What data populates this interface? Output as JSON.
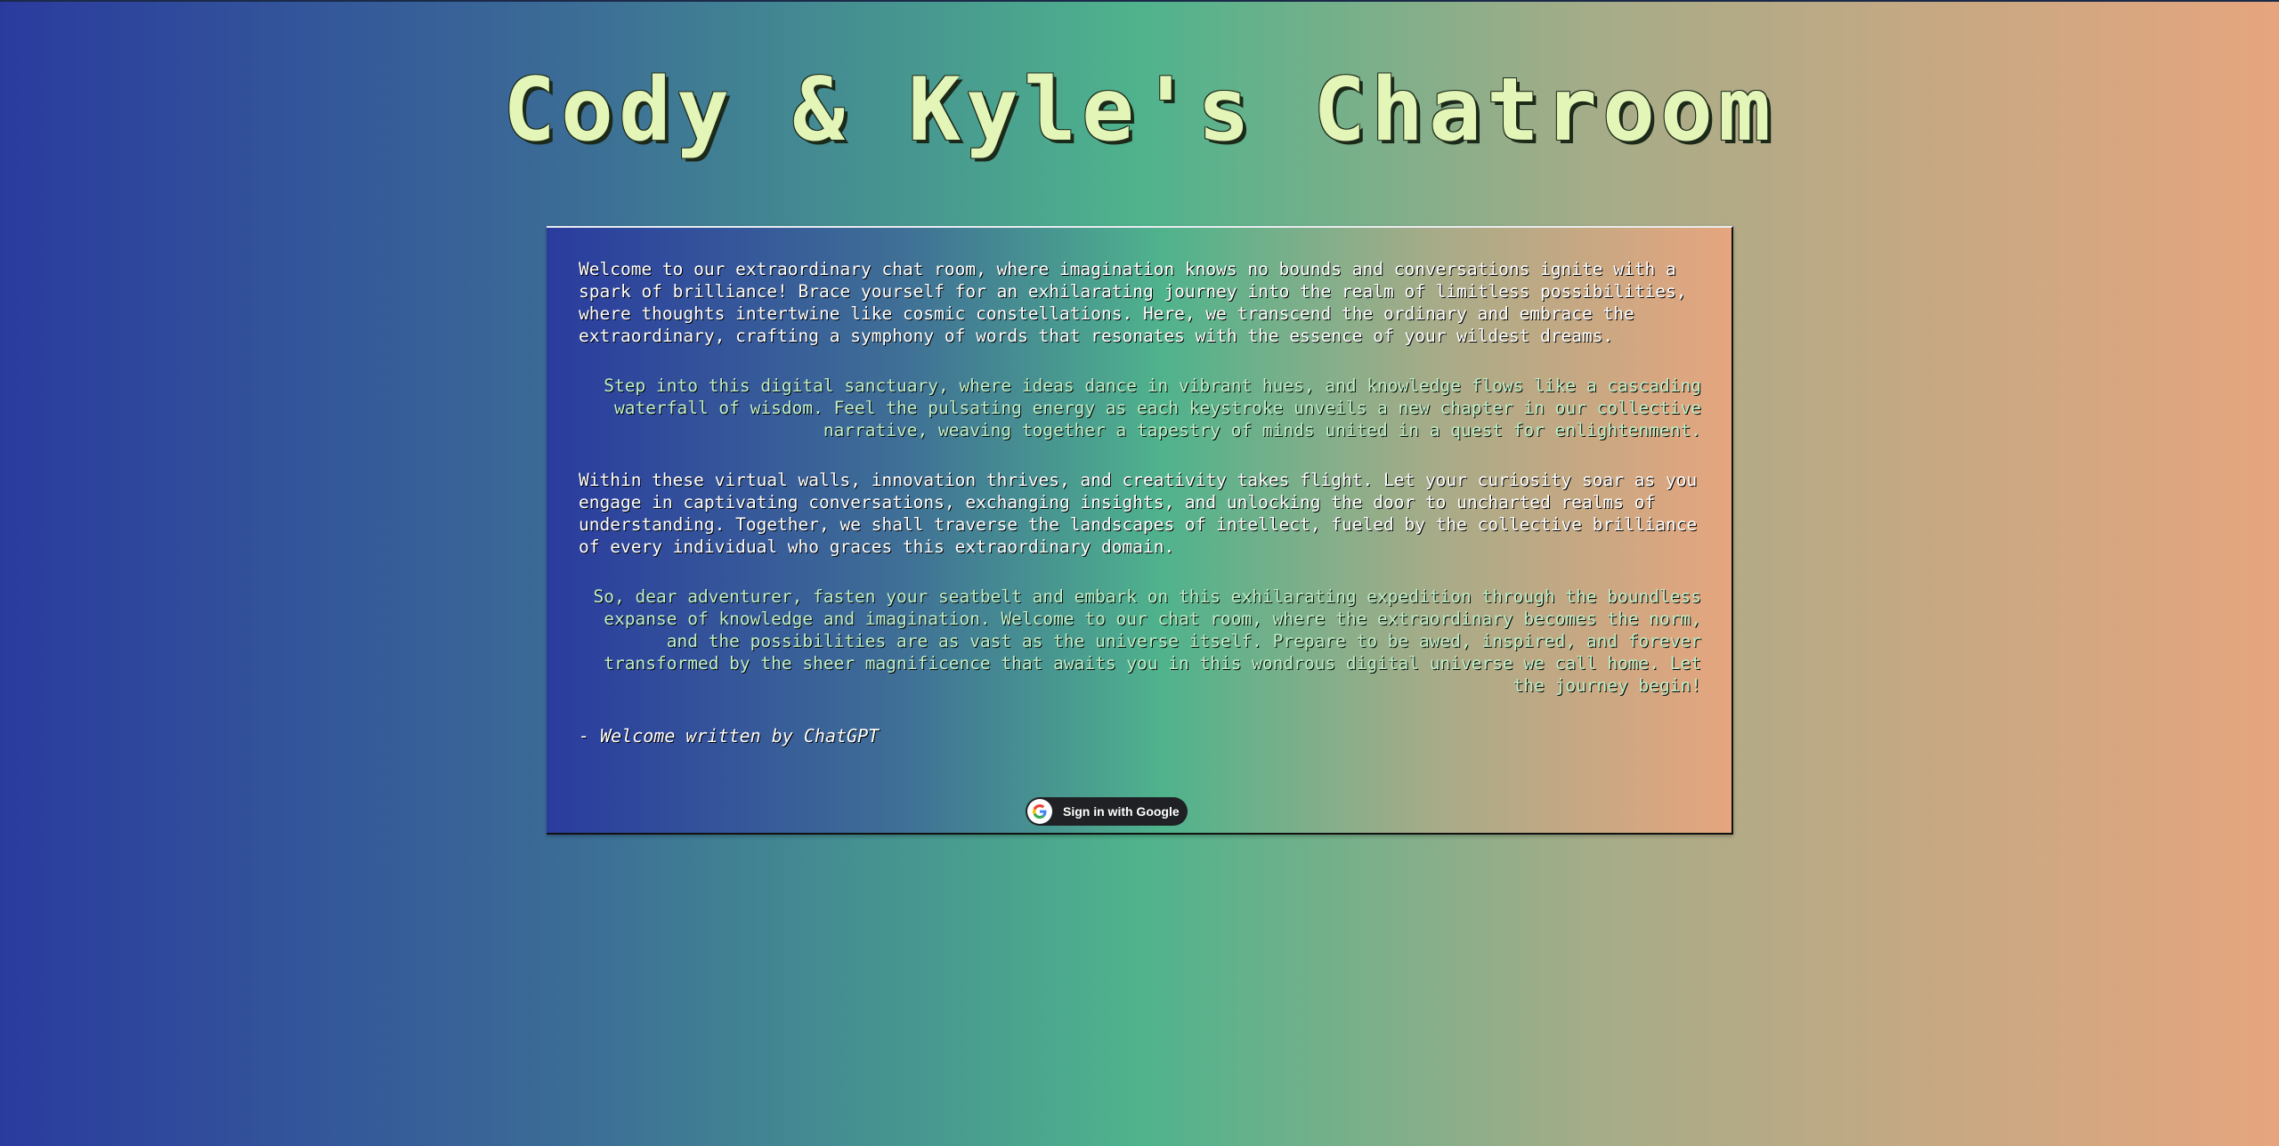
{
  "header": {
    "title": "Cody & Kyle's Chatroom"
  },
  "welcome": {
    "paragraphs": [
      "Welcome to our extraordinary chat room, where imagination knows no bounds and conversations ignite with a spark of brilliance! Brace yourself for an exhilarating journey into the realm of limitless possibilities, where thoughts intertwine like cosmic constellations. Here, we transcend the ordinary and embrace the extraordinary, crafting a symphony of words that resonates with the essence of your wildest dreams.",
      "Step into this digital sanctuary, where ideas dance in vibrant hues, and knowledge flows like a cascading waterfall of wisdom. Feel the pulsating energy as each keystroke unveils a new chapter in our collective narrative, weaving together a tapestry of minds united in a quest for enlightenment.",
      "Within these virtual walls, innovation thrives, and creativity takes flight. Let your curiosity soar as you engage in captivating conversations, exchanging insights, and unlocking the door to uncharted realms of understanding. Together, we shall traverse the landscapes of intellect, fueled by the collective brilliance of every individual who graces this extraordinary domain.",
      "So, dear adventurer, fasten your seatbelt and embark on this exhilarating expedition through the boundless expanse of knowledge and imagination. Welcome to our chat room, where the extraordinary becomes the norm, and the possibilities are as vast as the universe itself. Prepare to be awed, inspired, and forever transformed by the sheer magnificence that awaits you in this wondrous digital universe we call home. Let the journey begin!"
    ],
    "signature": "- Welcome written by ChatGPT"
  },
  "auth": {
    "google_button_label": "Sign in with Google",
    "google_icon": "google-g-icon"
  },
  "colors": {
    "gradient_left": "#2a3b9e",
    "gradient_mid": "#4fb38c",
    "gradient_right": "#e6a57e",
    "title_color": "#e4f5b8",
    "accent_text": "#bff0c8"
  }
}
